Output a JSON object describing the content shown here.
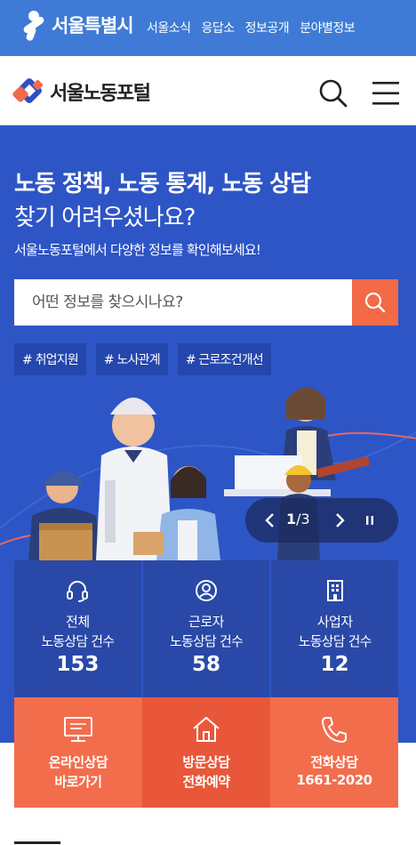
{
  "topbar": {
    "city_name": "서울특별시",
    "links": [
      "서울소식",
      "응답소",
      "정보공개",
      "분야별정보"
    ]
  },
  "header": {
    "site_name": "서울노동포털",
    "search_icon": "search-icon",
    "menu_icon": "hamburger-menu-icon"
  },
  "hero": {
    "title_line1": "노동 정책, 노동 통계, 노동 상담",
    "title_line2": "찾기 어려우셨나요?",
    "description": "서울노동포털에서 다양한 정보를 확인해보세요!",
    "search_placeholder": "어떤 정보를 찾으시나요?",
    "tags": [
      "# 취업지원",
      "# 노사관계",
      "# 근로조건개선"
    ],
    "slider": {
      "current": "1",
      "separator": "/",
      "total": "3"
    }
  },
  "stats": [
    {
      "icon": "headset-icon",
      "line1": "전체",
      "line2": "노동상담 건수",
      "count": "153"
    },
    {
      "icon": "user-icon",
      "line1": "근로자",
      "line2": "노동상담 건수",
      "count": "58"
    },
    {
      "icon": "building-icon",
      "line1": "사업자",
      "line2": "노동상담 건수",
      "count": "12"
    }
  ],
  "quick_links": [
    {
      "icon": "monitor-icon",
      "line1": "온라인상담",
      "line2": "바로가기"
    },
    {
      "icon": "house-icon",
      "line1": "방문상담",
      "line2": "전화예약"
    },
    {
      "icon": "phone-icon",
      "line1": "전화상담",
      "line2": "1661-2020"
    }
  ],
  "colors": {
    "top_bar": "#3f7bd6",
    "hero_bg": "#2e55c6",
    "stat_bg": "#2a48a7",
    "accent_orange": "#f36a47"
  }
}
